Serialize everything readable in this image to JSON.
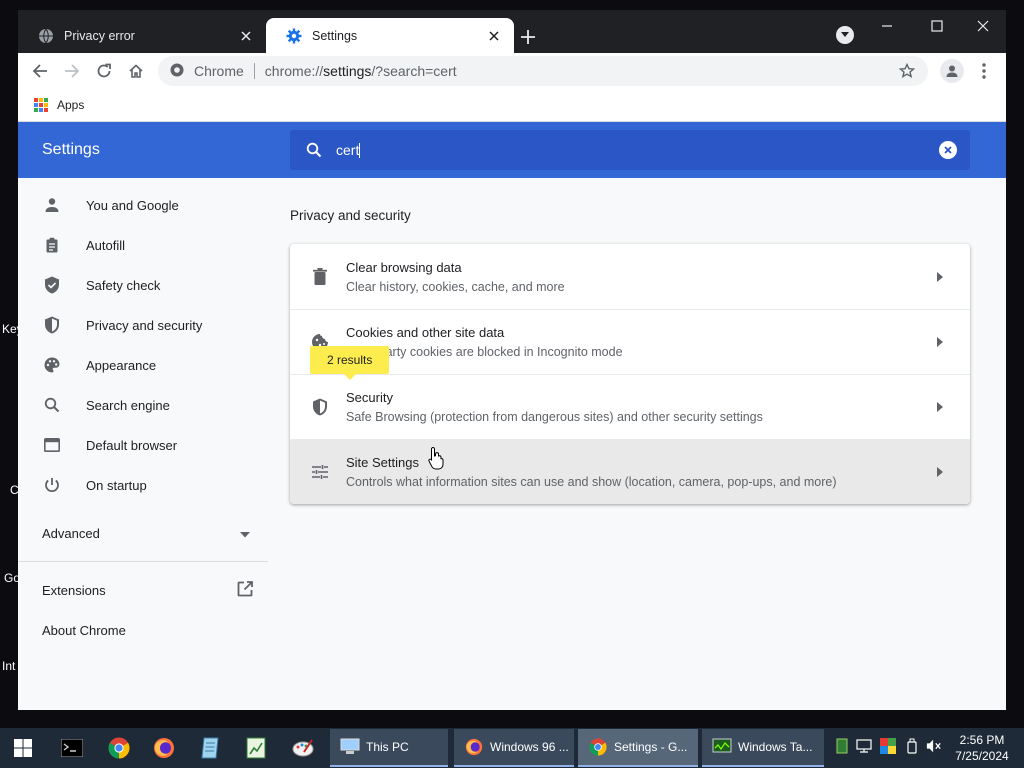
{
  "desktop": {
    "labels": [
      "Key",
      "C",
      "Go",
      "Int"
    ]
  },
  "browser": {
    "tabs": [
      {
        "title": "Privacy error",
        "icon": "globe-icon",
        "active": false
      },
      {
        "title": "Settings",
        "icon": "gear-icon",
        "active": true
      }
    ],
    "omnibox": {
      "site_chip": "Chrome",
      "url_prefix": "chrome://",
      "url_host": "settings",
      "url_suffix": "/?search=cert"
    },
    "bookmarks": {
      "apps_label": "Apps"
    }
  },
  "settings": {
    "title": "Settings",
    "search": {
      "value": "cert"
    },
    "nav": [
      {
        "label": "You and Google",
        "icon": "person-icon"
      },
      {
        "label": "Autofill",
        "icon": "clipboard-icon"
      },
      {
        "label": "Safety check",
        "icon": "shield-check-icon"
      },
      {
        "label": "Privacy and security",
        "icon": "shield-icon"
      },
      {
        "label": "Appearance",
        "icon": "palette-icon"
      },
      {
        "label": "Search engine",
        "icon": "search-icon"
      },
      {
        "label": "Default browser",
        "icon": "browser-window-icon"
      },
      {
        "label": "On startup",
        "icon": "power-icon"
      }
    ],
    "advanced_label": "Advanced",
    "extensions_label": "Extensions",
    "about_label": "About Chrome",
    "section_title": "Privacy and security",
    "results_bubble": "2 results",
    "rows": [
      {
        "title": "Clear browsing data",
        "subtitle": "Clear history, cookies, cache, and more",
        "icon": "trash-icon"
      },
      {
        "title": "Cookies and other site data",
        "subtitle": "Third-party cookies are blocked in Incognito mode",
        "icon": "cookie-icon"
      },
      {
        "title": "Security",
        "subtitle": "Safe Browsing (protection from dangerous sites) and other security settings",
        "icon": "shield-icon"
      },
      {
        "title": "Site Settings",
        "subtitle": "Controls what information sites can use and show (location, camera, pop-ups, and more)",
        "icon": "tune-icon"
      }
    ]
  },
  "taskbar": {
    "tasks": [
      {
        "label": "This PC"
      },
      {
        "label": "Windows 96 ..."
      },
      {
        "label": "Settings - G..."
      },
      {
        "label": "Windows Ta..."
      }
    ],
    "clock": {
      "time": "2:56 PM",
      "date": "7/25/2024"
    }
  },
  "colors": {
    "header_blue": "#3367d6",
    "search_blue": "#2a56c6",
    "highlight_yellow": "#fcec4e",
    "titlebar": "#202124",
    "taskbar": "#1e2a38"
  }
}
